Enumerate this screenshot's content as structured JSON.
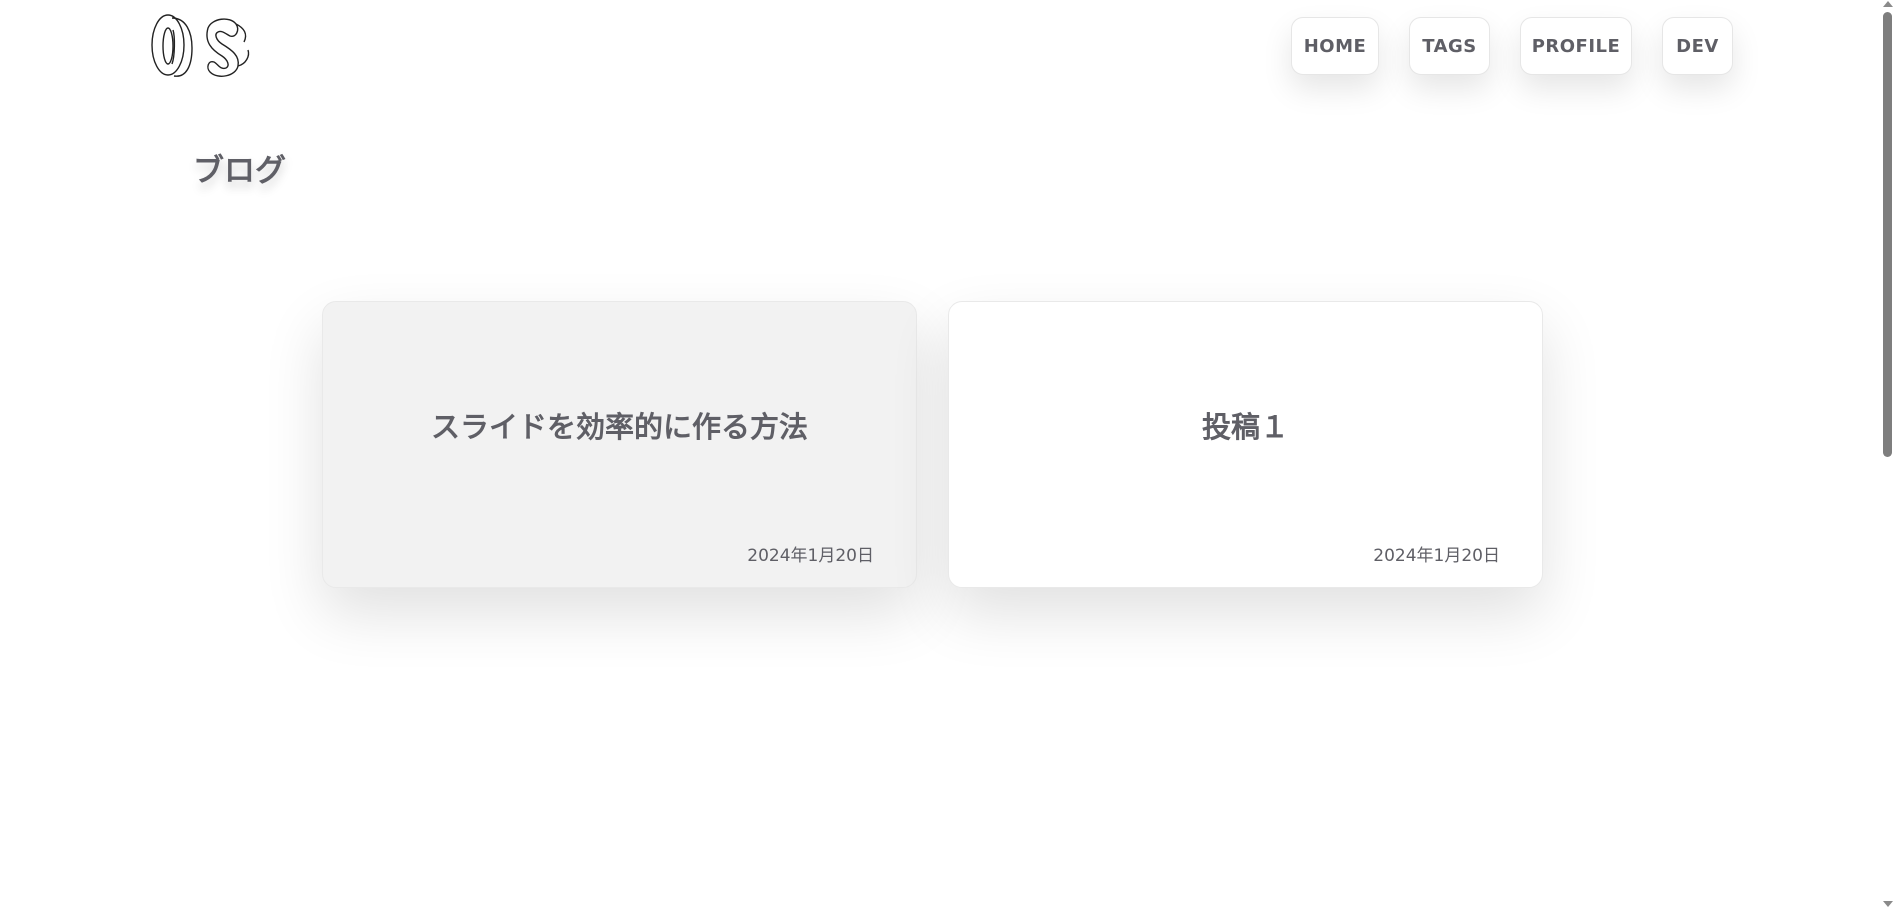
{
  "nav": {
    "items": [
      {
        "label": "HOME"
      },
      {
        "label": "TAGS"
      },
      {
        "label": "PROFILE"
      },
      {
        "label": "DEV"
      }
    ]
  },
  "page": {
    "title": "ブログ"
  },
  "posts": [
    {
      "title": "スライドを効率的に作る方法",
      "date": "2024年1月20日"
    },
    {
      "title": "投稿１",
      "date": "2024年1月20日"
    }
  ],
  "colors": {
    "text": "#5f5f66",
    "card_active_bg": "#f2f2f2",
    "card_bg": "#ffffff"
  }
}
